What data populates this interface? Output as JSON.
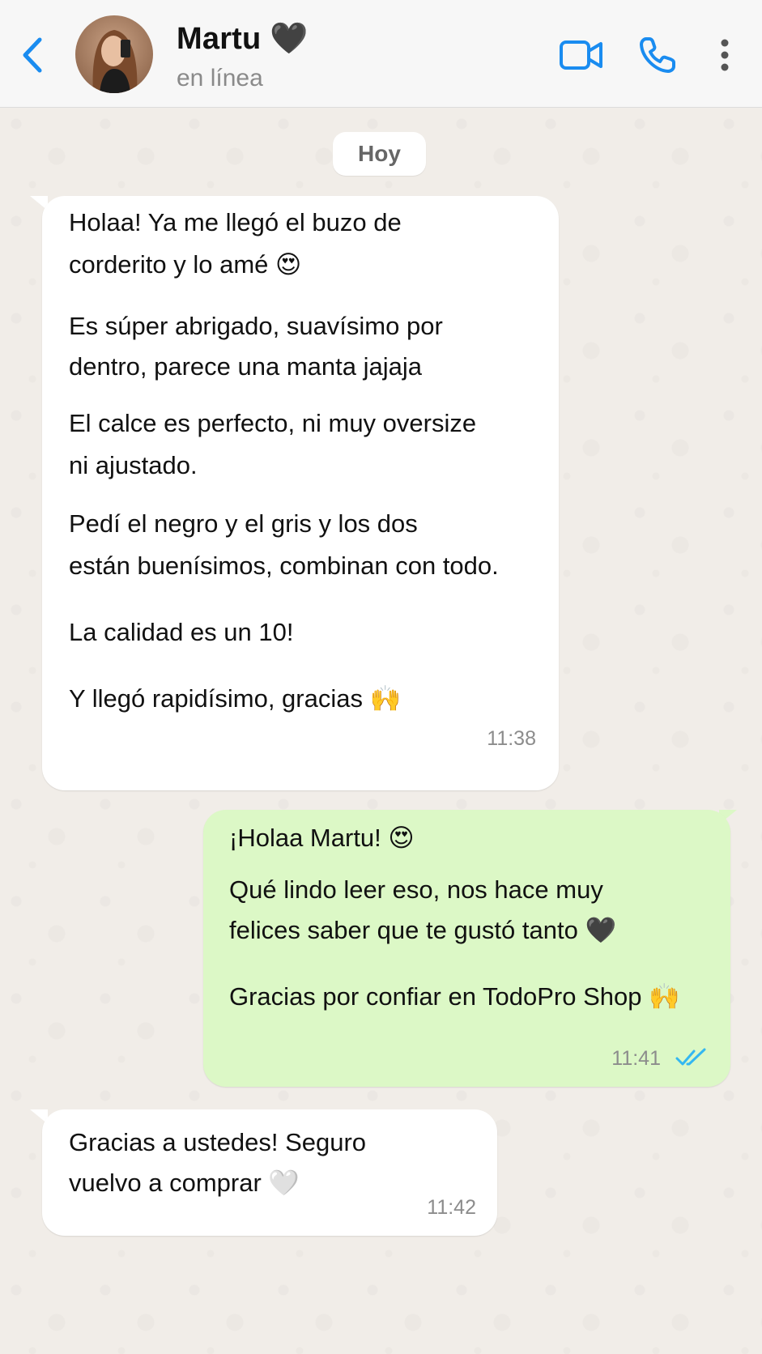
{
  "header": {
    "back_icon": "chevron-left-icon",
    "contact_name": "Martu 🖤",
    "status": "en línea",
    "video_icon": "video-camera-icon",
    "call_icon": "phone-icon",
    "more_icon": "more-vertical-icon",
    "accent_color": "#1a8cf0"
  },
  "date_chip": "Hoy",
  "messages": [
    {
      "direction": "incoming",
      "lines": [
        "Holaa! Ya me llegó el buzo de",
        "corderito y lo amé 😍",
        "Es súper abrigado, suavísimo por",
        "dentro, parece una manta jajaja",
        "El calce es perfecto, ni muy oversize",
        "ni ajustado.",
        "Pedí el negro y el gris y los dos",
        "están buenísimos, combinan con todo.",
        "La calidad es un 10!",
        "Y llegó rapidísimo, gracias 🙌"
      ],
      "time": "11:38"
    },
    {
      "direction": "outgoing",
      "lines": [
        "¡Holaa Martu! 😍",
        "Qué lindo leer eso, nos hace muy",
        "felices saber que te gustó tanto 🖤",
        "Gracias por confiar en TodoPro Shop 🙌"
      ],
      "time": "11:41",
      "status_icon": "double-check-read-icon",
      "bubble_color": "#dcf8c6"
    },
    {
      "direction": "incoming",
      "lines": [
        "Gracias a ustedes! Seguro",
        "vuelvo a comprar 🤍"
      ],
      "time": "11:42"
    }
  ]
}
